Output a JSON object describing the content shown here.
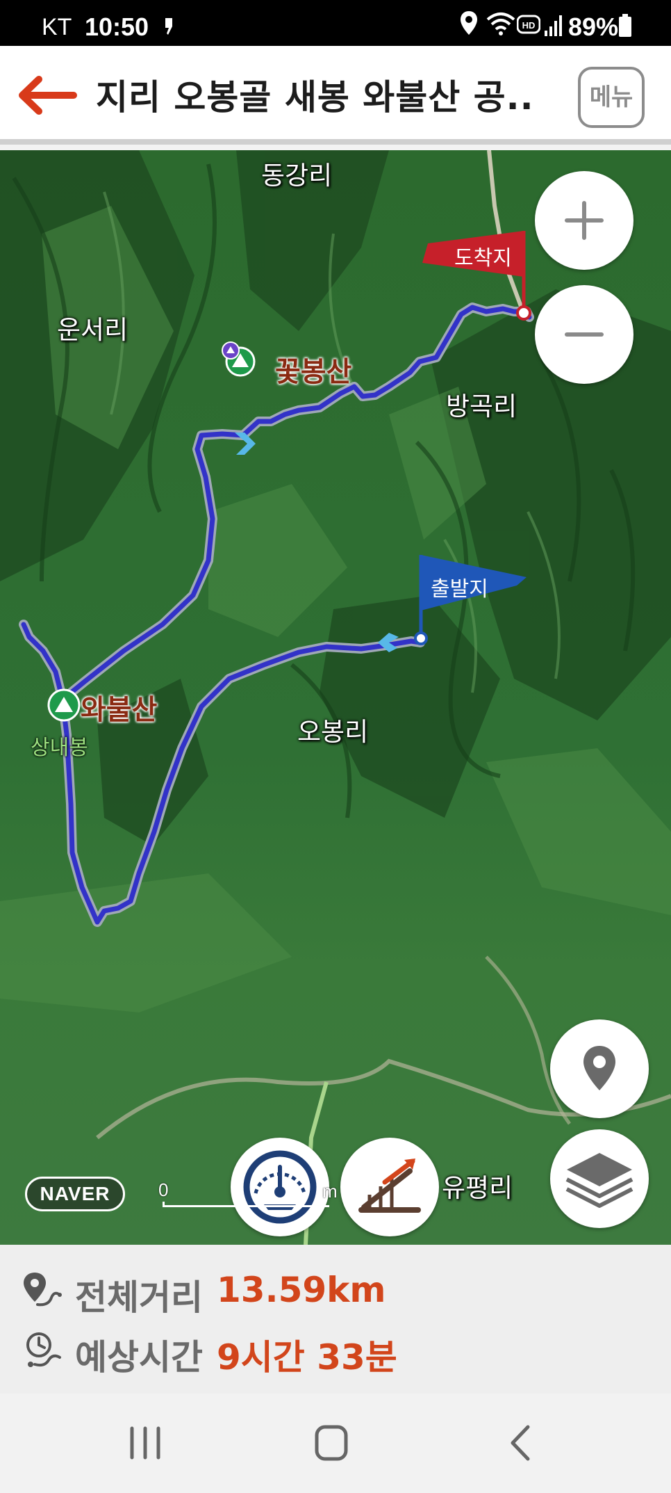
{
  "status_bar": {
    "carrier": "KT",
    "time": "10:50",
    "battery": "89%",
    "icons": [
      "location-icon",
      "wifi-icon",
      "hd-voice-icon",
      "signal-icon",
      "battery-icon"
    ]
  },
  "header": {
    "title": "지리 오봉골 새봉 와불산 공...",
    "menu_label": "메뉴",
    "back_icon": "back-arrow-icon",
    "accent_color": "#d83a1a"
  },
  "map": {
    "places": {
      "donggang": "동강리",
      "unseo": "운서리",
      "banggok": "방곡리",
      "obong": "오봉리",
      "yupyeong": "유평리"
    },
    "peaks": {
      "kkotbong": "꽃봉산",
      "wabul": "와불산",
      "sangnae": "상내봉"
    },
    "flags": {
      "arrival": "도착지",
      "departure": "출발지",
      "arrival_color": "#c6202a",
      "departure_color": "#1f57b8"
    },
    "controls": {
      "zoom_in_icon": "plus-icon",
      "zoom_out_icon": "minus-icon",
      "location_icon": "location-pin-icon",
      "layers_icon": "layers-icon",
      "speed_icon": "speedometer-icon",
      "elevation_icon": "elevation-chart-icon"
    },
    "attribution": "NAVER",
    "scale_zero": "0",
    "scale_unit": "m",
    "route_color": "#3232c8"
  },
  "info": {
    "distance_label": "전체거리",
    "distance_value": "13.59km",
    "time_label": "예상시간",
    "time_value": "9시간 33분",
    "value_color": "#d2451b"
  },
  "nav_bar": {
    "icons": [
      "recent-apps-icon",
      "home-icon",
      "back-icon"
    ]
  }
}
